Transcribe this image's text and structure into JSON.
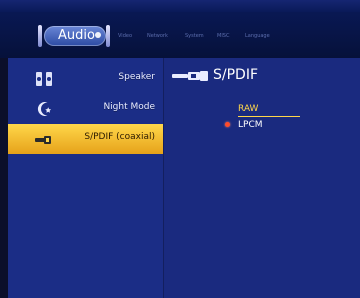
{
  "topbar": {
    "active_tab_label": "Audio",
    "inactive_tabs": [
      "Video",
      "Network",
      "System",
      "MISC",
      "Language"
    ]
  },
  "sidebar": {
    "items": [
      {
        "label": "Speaker",
        "icon": "speaker-icon",
        "selected": false
      },
      {
        "label": "Night Mode",
        "icon": "moon-star-icon",
        "selected": false
      },
      {
        "label": "S/PDIF (coaxial)",
        "icon": "spdif-plug-icon",
        "selected": true
      }
    ]
  },
  "detail": {
    "title": "S/PDIF",
    "options": [
      {
        "label": "RAW",
        "highlighted": true
      },
      {
        "label": "LPCM",
        "selected": true
      }
    ]
  },
  "colors": {
    "selected_bg": "#FFD74A",
    "panel_bg": "#1B2D86",
    "highlight": "#FFD74A",
    "radio": "#FF4A2A"
  }
}
